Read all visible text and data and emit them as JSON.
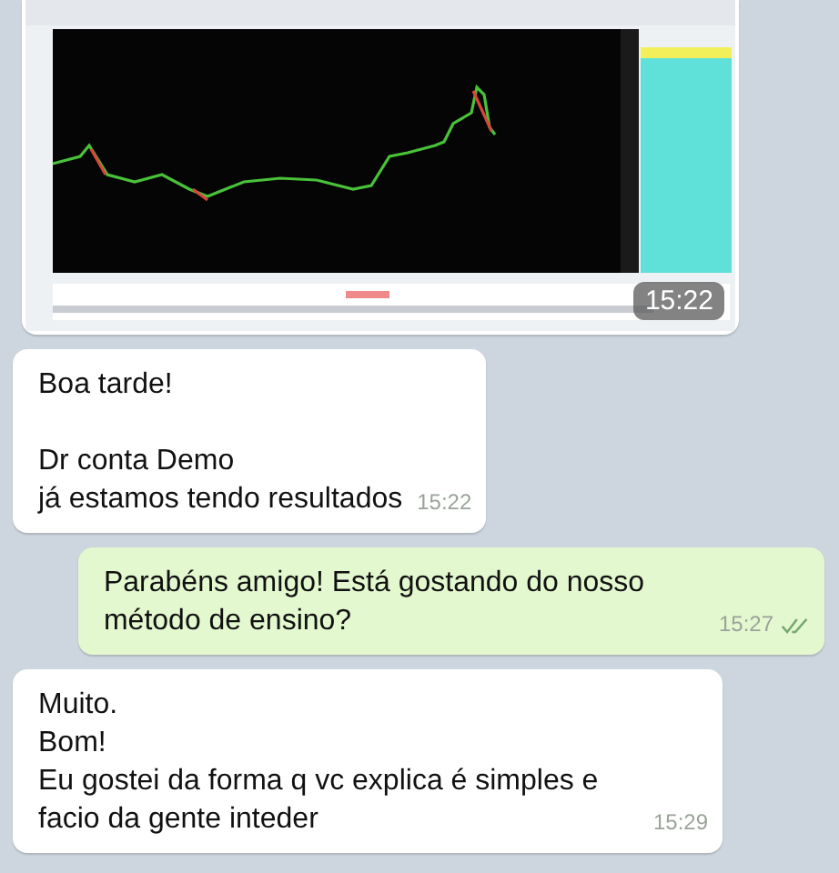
{
  "messages": [
    {
      "outgoing": false,
      "time": "15:22"
    },
    {
      "kind": "text",
      "outgoing": false,
      "text": "Boa tarde!\n\nDr conta Demo\njá estamos tendo resultados",
      "time": "15:22"
    },
    {
      "kind": "text",
      "outgoing": true,
      "text": "Parabéns amigo! Está gostando do nosso método de ensino?",
      "time": "15:27",
      "delivered": true
    },
    {
      "kind": "text",
      "outgoing": false,
      "text": "Muito.\nBom!\nEu gostei da forma q vc explica é simples e facio da gente inteder",
      "time": "15:29"
    }
  ]
}
